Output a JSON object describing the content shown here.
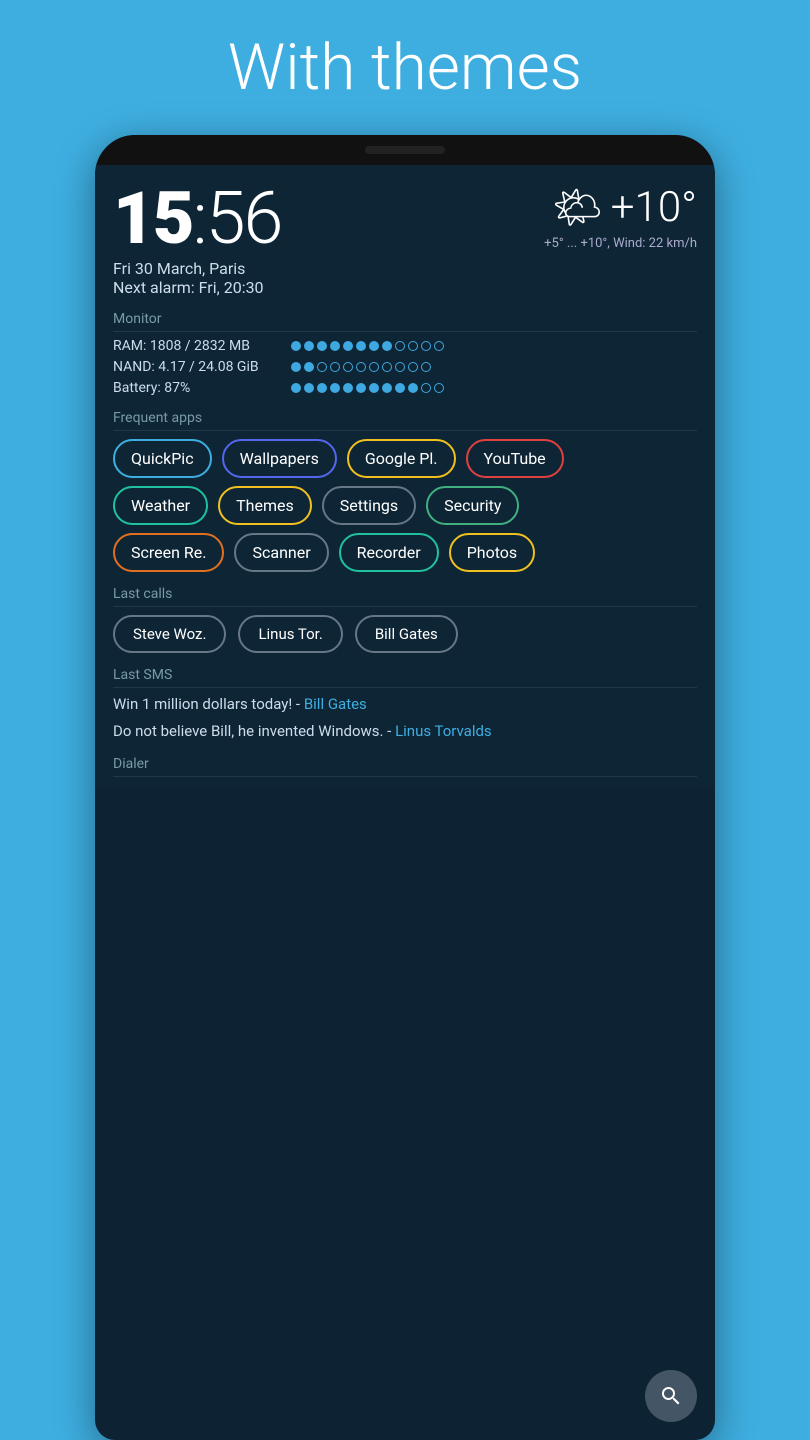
{
  "header": {
    "title": "With themes"
  },
  "clock": {
    "hours": "15",
    "minutes": "56",
    "date": "Fri 30 March, Paris",
    "alarm": "Next alarm: Fri, 20:30"
  },
  "weather": {
    "icon": "🌤",
    "temperature": "+10°",
    "detail": "+5° ... +10°, Wind: 22 km/h"
  },
  "monitor": {
    "label": "Monitor",
    "ram": {
      "label": "RAM: 1808 / 2832 MB",
      "filled": 8,
      "empty": 4
    },
    "nand": {
      "label": "NAND: 4.17 / 24.08 GiB",
      "filled": 2,
      "empty": 9
    },
    "battery": {
      "label": "Battery: 87%",
      "filled": 10,
      "empty": 2
    }
  },
  "frequent_apps": {
    "label": "Frequent apps",
    "row1": [
      {
        "name": "QuickPic",
        "color_class": "chip-blue"
      },
      {
        "name": "Wallpapers",
        "color_class": "chip-indigo"
      },
      {
        "name": "Google Pl.",
        "color_class": "chip-yellow"
      },
      {
        "name": "YouTube",
        "color_class": "chip-red"
      }
    ],
    "row2": [
      {
        "name": "Weather",
        "color_class": "chip-teal"
      },
      {
        "name": "Themes",
        "color_class": "chip-yellow"
      },
      {
        "name": "Settings",
        "color_class": "chip-gray"
      },
      {
        "name": "Security",
        "color_class": "chip-green"
      }
    ],
    "row3": [
      {
        "name": "Screen Re.",
        "color_class": "chip-orange"
      },
      {
        "name": "Scanner",
        "color_class": "chip-gray"
      },
      {
        "name": "Recorder",
        "color_class": "chip-teal"
      },
      {
        "name": "Photos",
        "color_class": "chip-yellow"
      }
    ]
  },
  "last_calls": {
    "label": "Last calls",
    "contacts": [
      {
        "name": "Steve Woz."
      },
      {
        "name": "Linus Tor."
      },
      {
        "name": "Bill Gates"
      }
    ]
  },
  "last_sms": {
    "label": "Last SMS",
    "messages": [
      {
        "text": "Win 1 million dollars today! -",
        "author": "Bill Gates"
      },
      {
        "text": "Do not believe Bill, he invented Windows. -",
        "author": "Linus Torvalds"
      }
    ]
  },
  "dialer": {
    "label": "Dialer"
  }
}
